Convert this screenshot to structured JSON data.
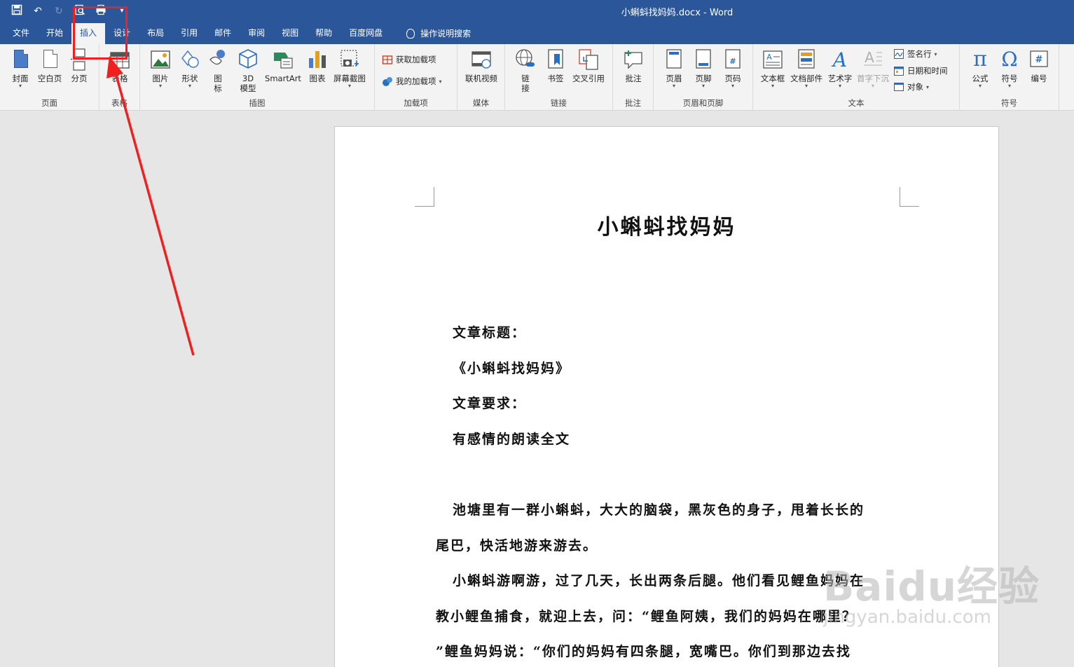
{
  "titlebar": {
    "title": "小蝌蚪找妈妈.docx  -  Word"
  },
  "tabs": [
    "文件",
    "开始",
    "插入",
    "设计",
    "布局",
    "引用",
    "邮件",
    "审阅",
    "视图",
    "帮助",
    "百度网盘"
  ],
  "tell_me": "操作说明搜索",
  "groups": {
    "pages": {
      "label": "页面",
      "cover": "封面",
      "blank": "空白页",
      "break": "分页"
    },
    "table": {
      "label": "表格",
      "table": "表格"
    },
    "illus": {
      "label": "插图",
      "pictures": "图片",
      "shapes": "形状",
      "icons1": "图",
      "icons2": "标",
      "model1": "3D",
      "model2": "模型",
      "smartart": "SmartArt",
      "chart": "图表",
      "screenshot": "屏幕截图"
    },
    "addins": {
      "label": "加载项",
      "get": "获取加载项",
      "my": "我的加载项"
    },
    "media": {
      "label": "媒体",
      "video": "联机视频"
    },
    "links": {
      "label": "链接",
      "link1": "链",
      "link2": "接",
      "bookmark": "书签",
      "xref": "交叉引用"
    },
    "comments": {
      "label": "批注",
      "comment": "批注"
    },
    "hf": {
      "label": "页眉和页脚",
      "header": "页眉",
      "footer": "页脚",
      "pagenum": "页码"
    },
    "text": {
      "label": "文本",
      "textbox": "文本框",
      "parts": "文档部件",
      "wordart": "艺术字",
      "dropcap": "首字下沉",
      "sigline": "签名行",
      "datetime": "日期和时间",
      "object": "对象"
    },
    "symbols": {
      "label": "符号",
      "equation": "公式",
      "symbol": "符号",
      "number": "编号"
    }
  },
  "document": {
    "title": "小蝌蚪找妈妈",
    "paras": [
      "文章标题：",
      "《小蝌蚪找妈妈》",
      "文章要求：",
      "有感情的朗读全文",
      "池塘里有一群小蝌蚪，大大的脑袋，黑灰色的身子，甩着长长的",
      "尾巴，快活地游来游去。",
      "小蝌蚪游啊游，过了几天，长出两条后腿。他们看见鲤鱼妈妈在",
      "教小鲤鱼捕食，就迎上去，问：“鲤鱼阿姨，我们的妈妈在哪里？",
      "”鲤鱼妈妈说：“你们的妈妈有四条腿，宽嘴巴。你们到那边去找"
    ]
  },
  "watermark": {
    "main": "Baidu经验",
    "sub": "jingyan.baidu.com"
  },
  "colors": {
    "titlebar": "#2b579a",
    "ribbon": "#f3f3f3",
    "highlight": "#f02020"
  }
}
